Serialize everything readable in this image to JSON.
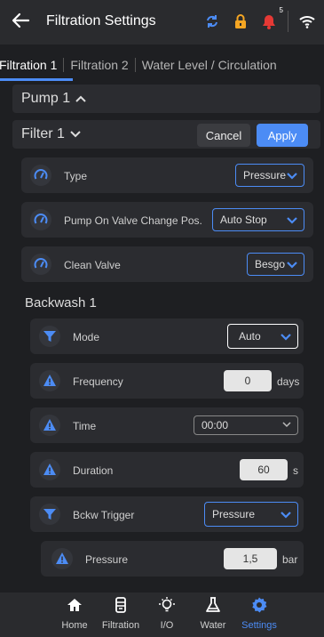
{
  "header": {
    "title": "Filtration Settings",
    "notification_count": "5",
    "icons": [
      "back-arrow-icon",
      "sync-icon",
      "lock-icon",
      "bell-icon",
      "wifi-icon"
    ],
    "colors": {
      "sync": "#4c8cf5",
      "lock": "#f5a623",
      "bell": "#e53935"
    }
  },
  "tabs": [
    "Filtration 1",
    "Filtration 2",
    "Water Level / Circulation"
  ],
  "pump": {
    "label": "Pump 1"
  },
  "filter": {
    "label": "Filter 1",
    "cancel": "Cancel",
    "apply": "Apply"
  },
  "filter_rows": [
    {
      "label": "Type",
      "value": "Pressure"
    },
    {
      "label": "Pump On Valve Change Pos.",
      "value": "Auto Stop"
    },
    {
      "label": "Clean Valve",
      "value": "Besgo"
    }
  ],
  "backwash": {
    "title": "Backwash 1",
    "mode": {
      "label": "Mode",
      "value": "Auto"
    },
    "frequency": {
      "label": "Frequency",
      "value": "0",
      "unit": "days"
    },
    "time": {
      "label": "Time",
      "value": "00:00"
    },
    "duration": {
      "label": "Duration",
      "value": "60",
      "unit": "s"
    },
    "trigger": {
      "label": "Bckw Trigger",
      "value": "Pressure"
    },
    "pressure": {
      "label": "Pressure",
      "value": "1,5",
      "unit": "bar"
    }
  },
  "nav": [
    {
      "label": "Home"
    },
    {
      "label": "Filtration"
    },
    {
      "label": "I/O"
    },
    {
      "label": "Water"
    },
    {
      "label": "Settings"
    }
  ],
  "accent": "#4c8cf5"
}
